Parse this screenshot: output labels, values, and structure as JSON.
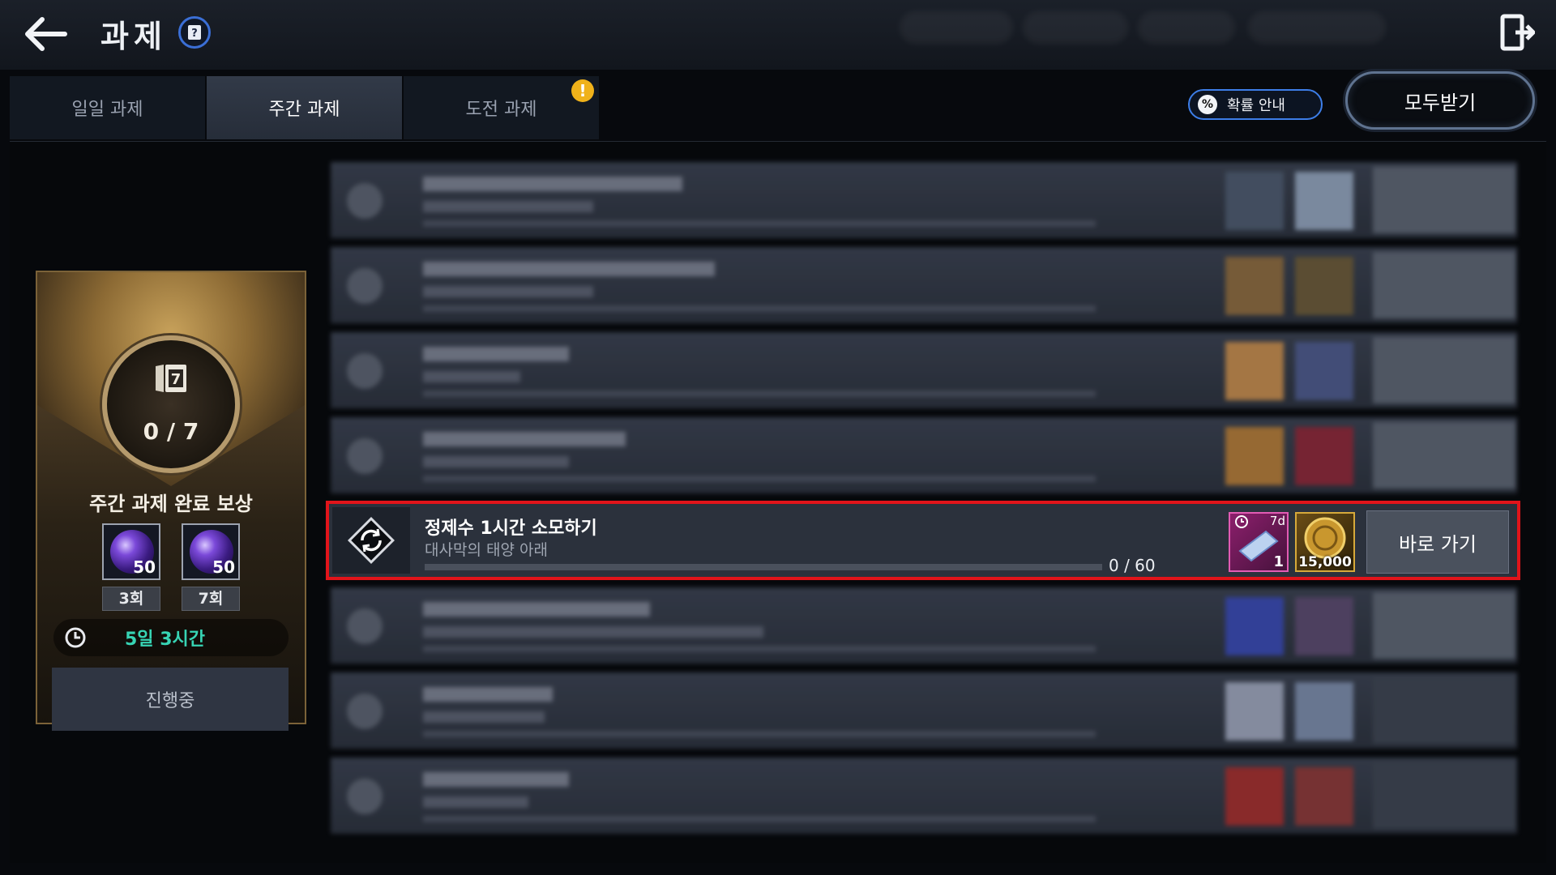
{
  "header": {
    "title": "과제"
  },
  "tabs": [
    {
      "label": "일일 과제",
      "active": false
    },
    {
      "label": "주간 과제",
      "active": true
    },
    {
      "label": "도전 과제",
      "active": false,
      "alert": "!"
    }
  ],
  "actions": {
    "probability_label": "확률 안내",
    "probability_icon_text": "%",
    "claim_all_label": "모두받기"
  },
  "weekly_reward": {
    "icon_number": "7",
    "progress": "0 / 7",
    "title": "주간 과제 완료 보상",
    "items": [
      {
        "count": "50",
        "label": "3회"
      },
      {
        "count": "50",
        "label": "7회"
      }
    ],
    "time_remaining": "5일 3시간",
    "status_label": "진행중"
  },
  "active_quest": {
    "title": "정제수 1시간 소모하기",
    "subtitle": "대사막의 태양 아래",
    "progress_text": "0 / 60",
    "progress_fraction": 0.0,
    "rewards": [
      {
        "icon": "voucher-icon",
        "duration": "7d",
        "count": "1"
      },
      {
        "icon": "gold-coin-icon",
        "count": "15,000"
      }
    ],
    "button_label": "바로 가기"
  },
  "colors": {
    "highlight": "#e1141a",
    "accent_blue": "#3d7ee8",
    "timer_text": "#37d4b4",
    "alert": "#f0b21a"
  }
}
